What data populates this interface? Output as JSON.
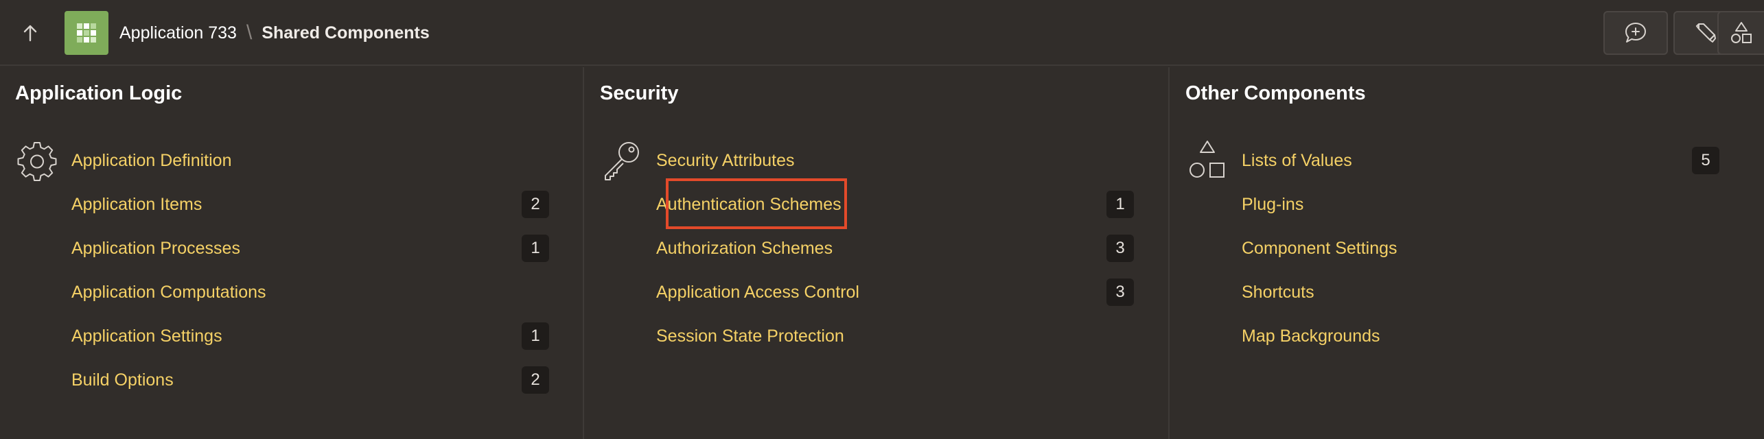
{
  "header": {
    "up_button_label": "↑",
    "app_name": "Application 733",
    "separator": "\\",
    "current_page": "Shared Components",
    "buttons": [
      {
        "name": "add-comment-icon"
      },
      {
        "name": "marker-icon"
      },
      {
        "name": "shapes-icon"
      }
    ]
  },
  "columns": [
    {
      "title": "Application Logic",
      "icon": "gear-icon",
      "items": [
        {
          "label": "Application Definition",
          "count": ""
        },
        {
          "label": "Application Items",
          "count": "2"
        },
        {
          "label": "Application Processes",
          "count": "1"
        },
        {
          "label": "Application Computations",
          "count": ""
        },
        {
          "label": "Application Settings",
          "count": "1"
        },
        {
          "label": "Build Options",
          "count": "2"
        }
      ]
    },
    {
      "title": "Security",
      "icon": "key-icon",
      "items": [
        {
          "label": "Security Attributes",
          "count": ""
        },
        {
          "label": "Authentication Schemes",
          "count": "1"
        },
        {
          "label": "Authorization Schemes",
          "count": "3"
        },
        {
          "label": "Application Access Control",
          "count": "3"
        },
        {
          "label": "Session State Protection",
          "count": ""
        }
      ]
    },
    {
      "title": "Other Components",
      "icon": "shapes-icon",
      "items": [
        {
          "label": "Lists of Values",
          "count": "5"
        },
        {
          "label": "Plug-ins",
          "count": ""
        },
        {
          "label": "Component Settings",
          "count": ""
        },
        {
          "label": "Shortcuts",
          "count": ""
        },
        {
          "label": "Map Backgrounds",
          "count": ""
        }
      ]
    }
  ],
  "colors": {
    "background": "#312d2a",
    "link": "#f5d166",
    "highlight_border": "#e34a2a",
    "app_icon": "#7fac5a"
  }
}
